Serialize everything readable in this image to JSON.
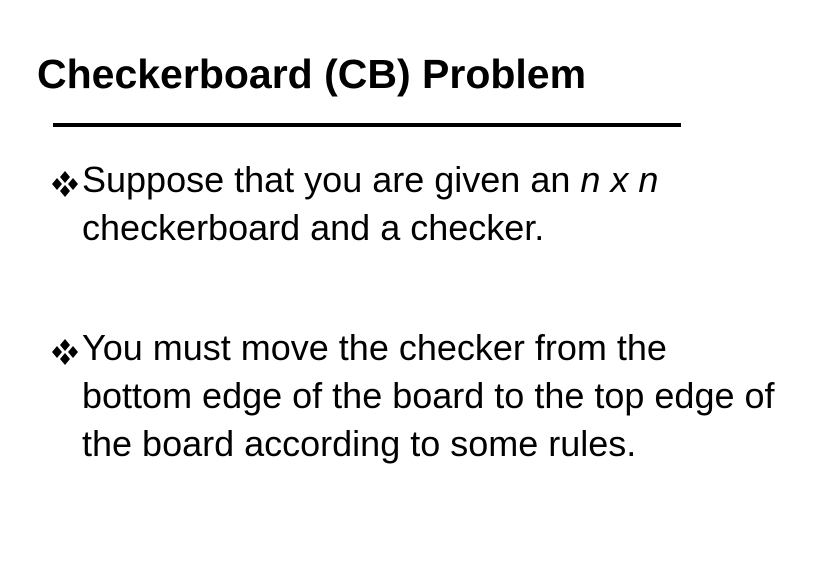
{
  "slide": {
    "title": "Checkerboard (CB) Problem",
    "bullet_icon": "four-diamond-bullet-icon",
    "bullets": [
      {
        "text_plain": "Suppose that you are given an ",
        "text_italic": "n x n",
        "text_tail": "checkerboard and a checker."
      },
      {
        "text": "You must move the checker from the bottom edge of the board to the top edge of the board according to some rules."
      }
    ]
  }
}
